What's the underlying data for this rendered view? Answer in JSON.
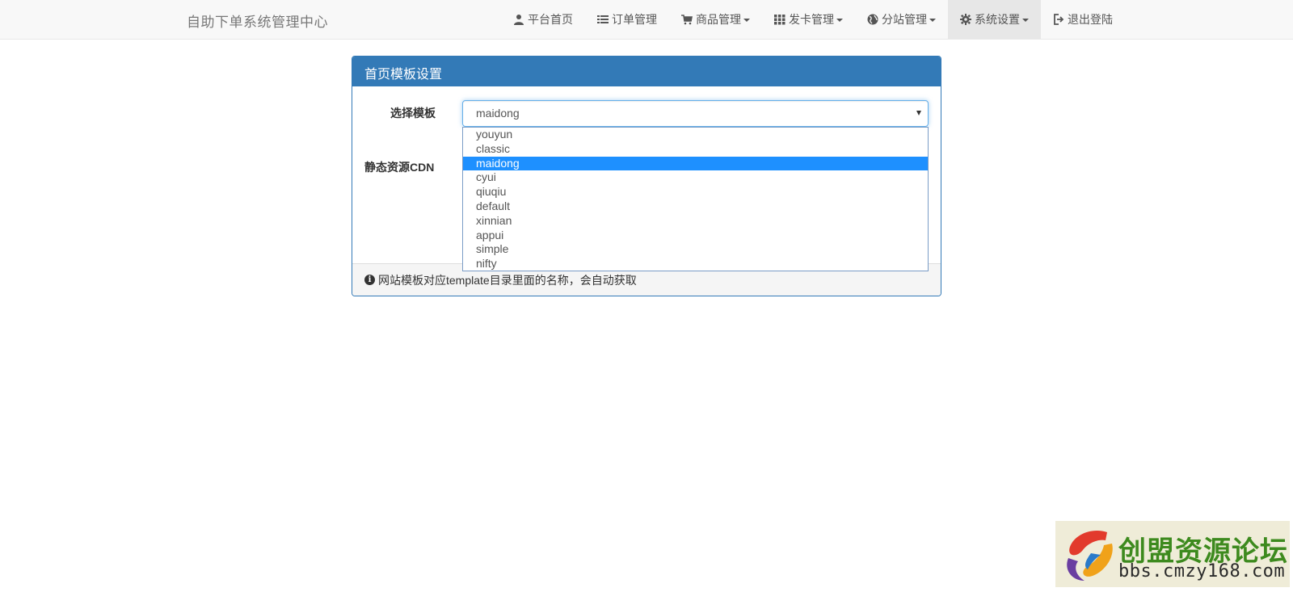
{
  "navbar": {
    "brand": "自助下单系统管理中心",
    "items": [
      {
        "label": "平台首页",
        "icon": "user-icon",
        "dropdown": false,
        "active": false
      },
      {
        "label": "订单管理",
        "icon": "list-icon",
        "dropdown": false,
        "active": false
      },
      {
        "label": "商品管理",
        "icon": "shopping-cart-icon",
        "dropdown": true,
        "active": false
      },
      {
        "label": "发卡管理",
        "icon": "grid-icon",
        "dropdown": true,
        "active": false
      },
      {
        "label": "分站管理",
        "icon": "globe-icon",
        "dropdown": true,
        "active": false
      },
      {
        "label": "系统设置",
        "icon": "gear-icon",
        "dropdown": true,
        "active": true
      },
      {
        "label": "退出登陆",
        "icon": "logout-icon",
        "dropdown": false,
        "active": false
      }
    ]
  },
  "panel": {
    "title": "首页模板设置",
    "template_label": "选择模板",
    "template_value": "maidong",
    "cdn_label": "静态资源CDN",
    "footer_note": "网站模板对应template目录里面的名称，会自动获取",
    "footer_icon": "info-icon"
  },
  "dropdown": {
    "options": [
      "youyun",
      "classic",
      "maidong",
      "cyui",
      "qiuqiu",
      "default",
      "xinnian",
      "appui",
      "simple",
      "nifty"
    ],
    "selected": "maidong"
  },
  "watermark": {
    "title": "创盟资源论坛",
    "url": "bbs.cmzy168.com"
  },
  "colors": {
    "primary": "#337ab7",
    "selected_option": "#1e90ff",
    "navbar_bg": "#f8f8f8",
    "watermark_green": "#3d8a1e"
  }
}
